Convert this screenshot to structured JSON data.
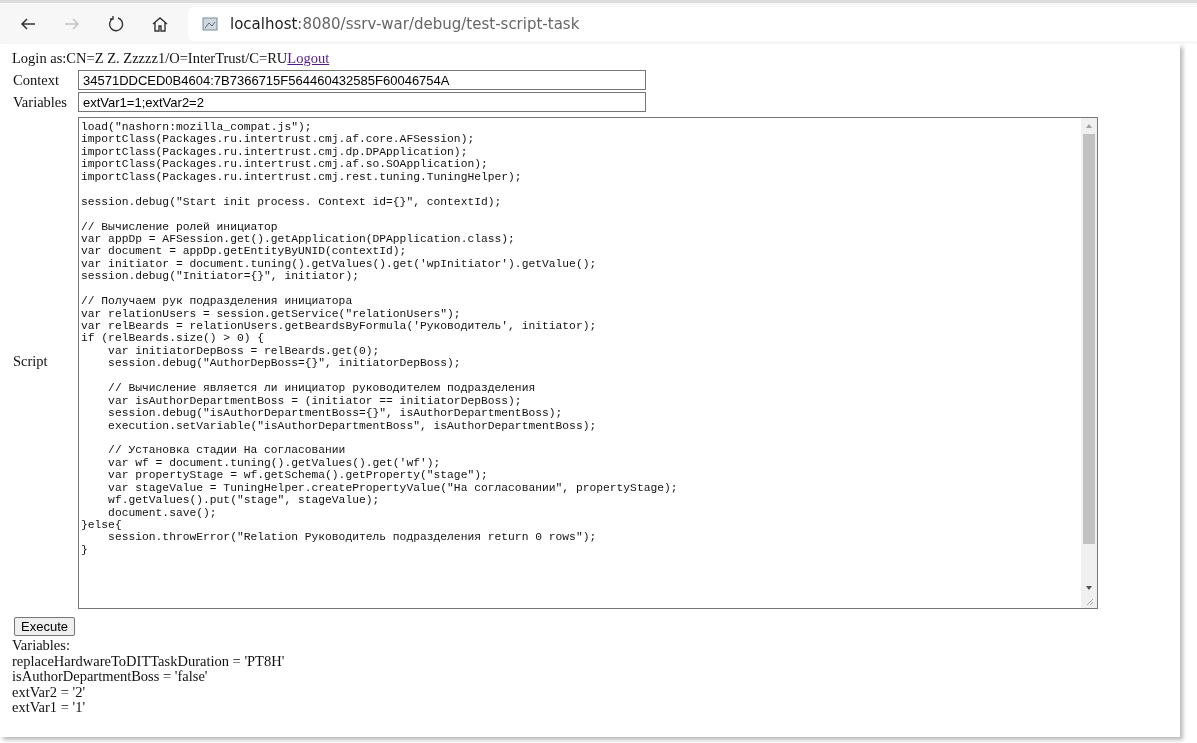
{
  "browser": {
    "back_disabled": false,
    "forward_disabled": true,
    "url_host": "localhost",
    "url_rest": ":8080/ssrv-war/debug/test-script-task"
  },
  "login": {
    "prefix": "Login as:CN=Z Z. Zzzzz1/O=InterTrust/C=RU",
    "link": "Logout"
  },
  "fields": [
    {
      "label": "Context",
      "value": "34571DDCED0B4604:7B7366715F564460432585F60046754A"
    },
    {
      "label": "Variables",
      "value": "extVar1=1;extVar2=2"
    }
  ],
  "script": {
    "label": "Script",
    "lines": [
      {
        "kind": "code",
        "text": "load(\"nashorn:mozilla_compat.js\");"
      },
      {
        "kind": "code",
        "text": "importClass(Packages.ru.intertrust.cmj.af.core.AFSession);"
      },
      {
        "kind": "code",
        "text": "importClass(Packages.ru.intertrust.cmj.dp.DPApplication);"
      },
      {
        "kind": "code",
        "text": "importClass(Packages.ru.intertrust.cmj.af.so.SOApplication);"
      },
      {
        "kind": "code",
        "text": "importClass(Packages.ru.intertrust.cmj.rest.tuning.TuningHelper);"
      },
      {
        "kind": "blank"
      },
      {
        "kind": "code",
        "text": "session.debug(\"Start init process. Context id={}\", contextId);"
      },
      {
        "kind": "blank"
      },
      {
        "kind": "code",
        "text": "// Вычисление ролей инициатор"
      },
      {
        "kind": "code",
        "text": "var appDp = AFSession.get().getApplication(DPApplication.class);"
      },
      {
        "kind": "code",
        "text": "var document = appDp.getEntityByUNID(contextId);"
      },
      {
        "kind": "code",
        "text": "var initiator = document.tuning().getValues().get('wpInitiator').getValue();"
      },
      {
        "kind": "code",
        "text": "session.debug(\"Initiator={}\", initiator);"
      },
      {
        "kind": "blank"
      },
      {
        "kind": "code",
        "text": "// Получаем рук подразделения инициатора"
      },
      {
        "kind": "code",
        "text": "var relationUsers = session.getService(\"relationUsers\");"
      },
      {
        "kind": "code",
        "text": "var relBeards = relationUsers.getBeardsByFormula('Руководитель', initiator);"
      },
      {
        "kind": "code",
        "text": "if (relBeards.size() > 0) {"
      },
      {
        "kind": "code",
        "text": "    var initiatorDepBoss = relBeards.get(0);"
      },
      {
        "kind": "code",
        "text": "    session.debug(\"AuthorDepBoss={}\", initiatorDepBoss);"
      },
      {
        "kind": "blank"
      },
      {
        "kind": "code",
        "text": "    // Вычисление является ли инициатор руководителем подразделения"
      },
      {
        "kind": "code",
        "text": "    var isAuthorDepartmentBoss = (initiator == initiatorDepBoss);"
      },
      {
        "kind": "code",
        "text": "    session.debug(\"isAuthorDepartmentBoss={}\", isAuthorDepartmentBoss);"
      },
      {
        "kind": "code",
        "text": "    execution.setVariable(\"isAuthorDepartmentBoss\", isAuthorDepartmentBoss);"
      },
      {
        "kind": "blank"
      },
      {
        "kind": "code",
        "text": "    // Установка стадии На согласовании"
      },
      {
        "kind": "code",
        "text": "    var wf = document.tuning().getValues().get('wf');"
      },
      {
        "kind": "code",
        "text": "    var propertyStage = wf.getSchema().getProperty(\"stage\");"
      },
      {
        "kind": "code",
        "text": "    var stageValue = TuningHelper.createPropertyValue(\"На согласовании\", propertyStage);"
      },
      {
        "kind": "code",
        "text": "    wf.getValues().put(\"stage\", stageValue);"
      },
      {
        "kind": "code",
        "text": "    document.save();"
      },
      {
        "kind": "code",
        "text": "}else{"
      },
      {
        "kind": "code",
        "text": "    session.throwError(\"Relation Руководитель подразделения return 0 rows\");"
      },
      {
        "kind": "code",
        "text": "}"
      }
    ]
  },
  "execute_button": "Execute",
  "result": {
    "heading": "Variables:",
    "lines": [
      "replaceHardwareToDITTaskDuration = 'PT8H'",
      "isAuthorDepartmentBoss = 'false'",
      "extVar2 = '2'",
      "extVar1 = '1'"
    ]
  }
}
